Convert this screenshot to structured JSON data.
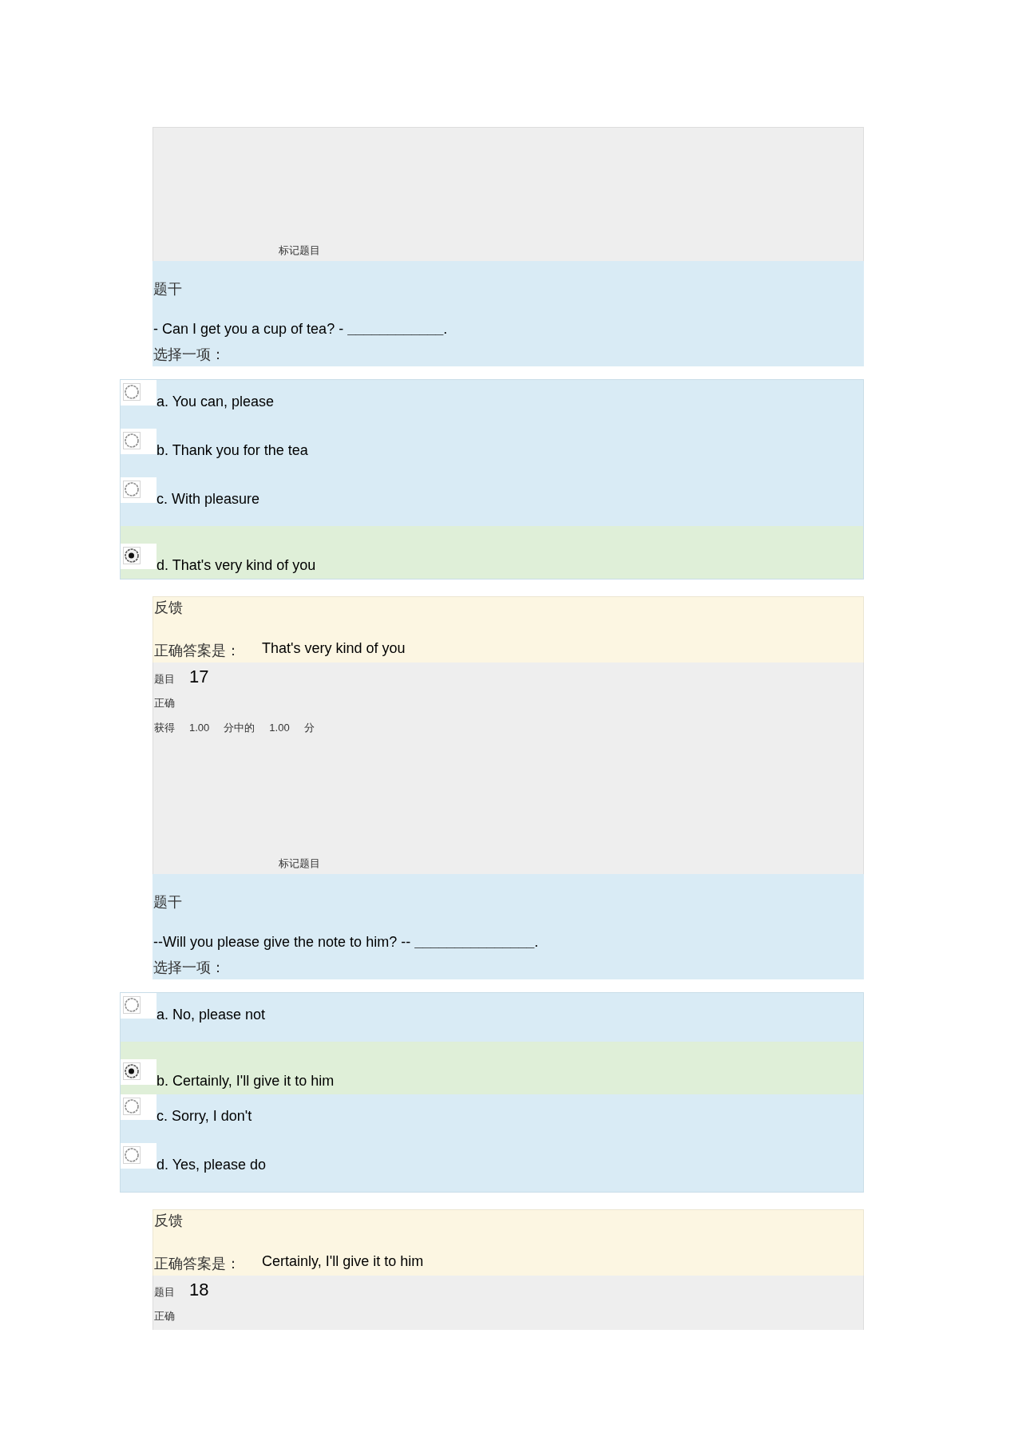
{
  "questions": [
    {
      "info": {
        "flag_label": "标记题目"
      },
      "stem": {
        "heading": "题干",
        "text": "- Can I get you a cup of tea? - **____________**.",
        "prompt": "选择一项："
      },
      "options": [
        {
          "label": "a. You can, please",
          "selected": false
        },
        {
          "label": "b. Thank you for the tea",
          "selected": false
        },
        {
          "label": "c. With pleasure",
          "selected": false
        },
        {
          "label": "d. That's very kind of you",
          "selected": true
        }
      ],
      "feedback": {
        "heading": "反馈",
        "answer_label": "正确答案是：",
        "answer": "That's very kind of you"
      }
    },
    {
      "info": {
        "number_label": "题目",
        "number": "17",
        "status": "正确",
        "score": {
          "earned_label": "获得",
          "earned": "1.00",
          "total_label": "分中的",
          "total": "1.00",
          "unit": "分"
        },
        "flag_label": "标记题目"
      },
      "stem": {
        "heading": "题干",
        "text": "--Will you please give the note to him? -- **_______________**.",
        "prompt": "选择一项："
      },
      "options": [
        {
          "label": "a. No, please not",
          "selected": false
        },
        {
          "label": "b. Certainly, I'll give it to him",
          "selected": true
        },
        {
          "label": "c. Sorry, I don't",
          "selected": false
        },
        {
          "label": "d. Yes, please do",
          "selected": false
        }
      ],
      "feedback": {
        "heading": "反馈",
        "answer_label": "正确答案是：",
        "answer": "Certainly, I'll give it to him"
      }
    },
    {
      "info": {
        "number_label": "题目",
        "number": "18",
        "status": "正确"
      }
    }
  ]
}
